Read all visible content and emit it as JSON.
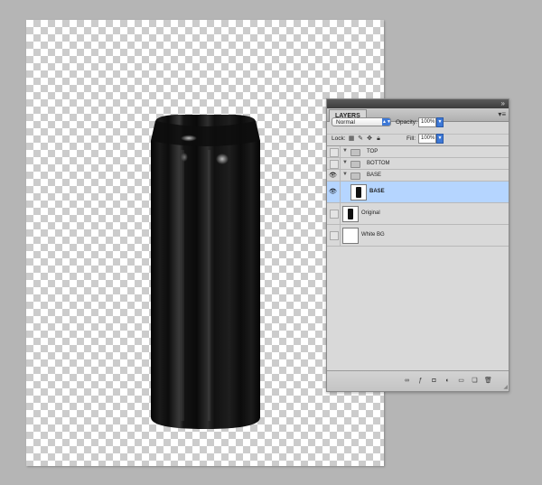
{
  "panel": {
    "tab_label": "LAYERS",
    "collapse_glyph": "»",
    "menu_glyph": "▾≡",
    "blend_mode": "Normal",
    "opacity_label": "Opacity:",
    "opacity_value": "100%",
    "lock_label": "Lock:",
    "fill_label": "Fill:",
    "fill_value": "100%"
  },
  "layers": [
    {
      "name": "TOP",
      "type": "group",
      "visible": false,
      "selected": false
    },
    {
      "name": "BOTTOM",
      "type": "group",
      "visible": false,
      "selected": false
    },
    {
      "name": "BASE",
      "type": "group",
      "visible": true,
      "selected": false
    },
    {
      "name": "BASE",
      "type": "layer",
      "visible": true,
      "selected": true
    },
    {
      "name": "Original",
      "type": "layer",
      "visible": false,
      "selected": false
    },
    {
      "name": "White BG",
      "type": "layer",
      "visible": false,
      "selected": false
    }
  ],
  "icons": {
    "eye": "eye-icon",
    "folder": "folder-icon",
    "expand": "triangle-down-icon",
    "lock_transparent": "lock-transparent-icon",
    "lock_paint": "brush-icon",
    "lock_move": "move-icon",
    "lock_all": "lock-icon"
  },
  "colors": {
    "selection": "#b5d5ff",
    "accent": "#3d78d6",
    "workspace": "#b5b5b5"
  }
}
